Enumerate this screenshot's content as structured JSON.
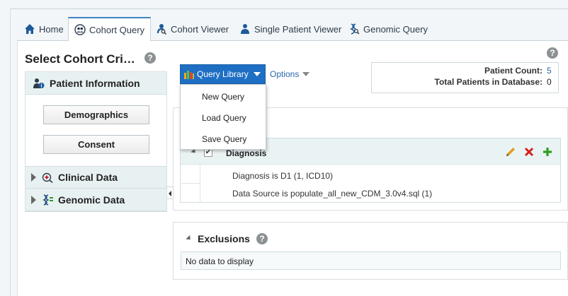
{
  "tabs": [
    {
      "label": "Home",
      "icon": "home-icon"
    },
    {
      "label": "Cohort Query",
      "icon": "cohort-query-icon",
      "active": true
    },
    {
      "label": "Cohort Viewer",
      "icon": "cohort-viewer-icon"
    },
    {
      "label": "Single Patient Viewer",
      "icon": "patient-icon"
    },
    {
      "label": "Genomic Query",
      "icon": "genomic-query-icon"
    }
  ],
  "left_panel": {
    "title": "Select Cohort Cri…",
    "help": "?",
    "patient_information": {
      "label": "Patient Information",
      "buttons": [
        "Demographics",
        "Consent"
      ]
    },
    "clinical_data": "Clinical Data",
    "genomic_data": "Genomic Data"
  },
  "query_library": {
    "label": "Query Library",
    "options_label": "Options",
    "menu": [
      "New Query",
      "Load Query",
      "Save Query"
    ]
  },
  "counts": {
    "help": "?",
    "patient_count_label": "Patient Count:",
    "patient_count_value": "5",
    "total_label": "Total Patients in Database:",
    "total_value": "0"
  },
  "inclusions": {
    "group_title": "Diagnosis",
    "checked_mark": "✔",
    "conditions": [
      "Diagnosis is D1 (1, ICD10)",
      "Data Source is populate_all_new_CDM_3.0v4.sql (1)"
    ]
  },
  "exclusions": {
    "title": "Exclusions",
    "help": "?",
    "empty_text": "No data to display"
  },
  "colors": {
    "accent": "#1e6fc4",
    "link": "#2b67a8",
    "edit": "#e39b1f",
    "delete": "#d4201c",
    "add": "#2e9e22"
  }
}
